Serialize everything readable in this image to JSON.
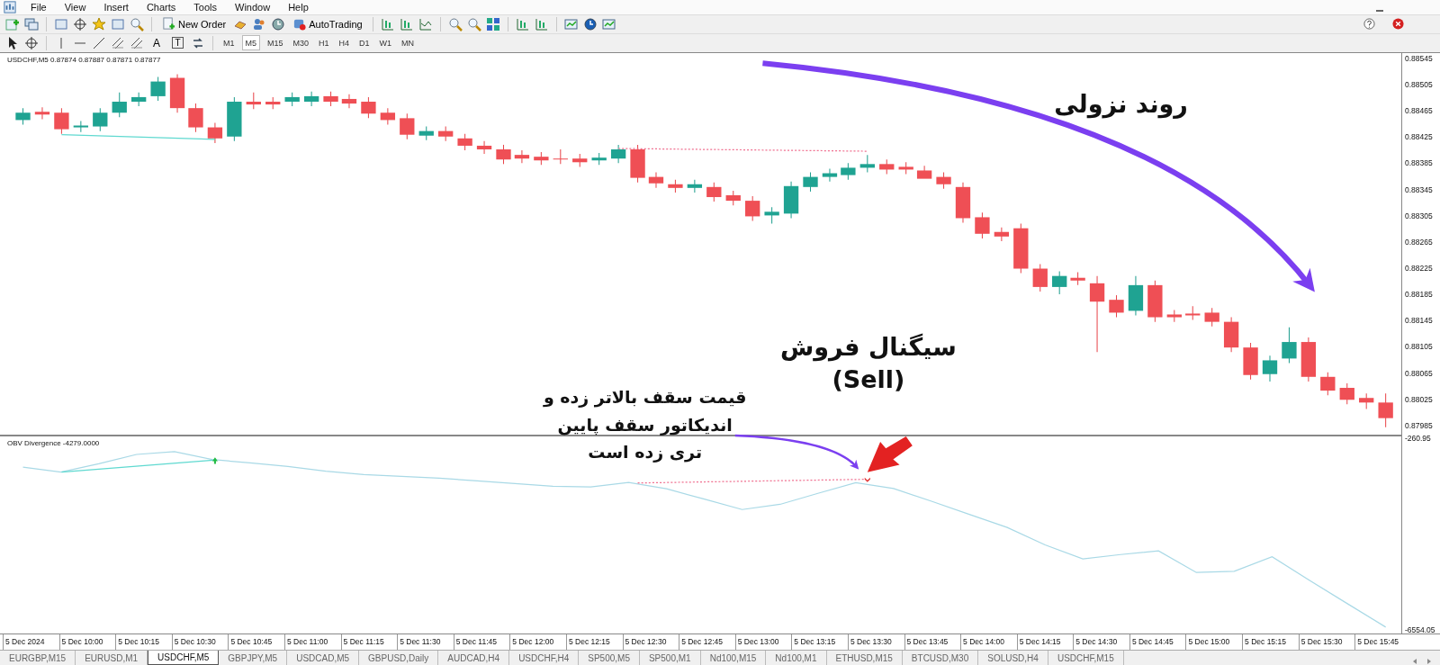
{
  "menu": [
    "File",
    "View",
    "Insert",
    "Charts",
    "Tools",
    "Window",
    "Help"
  ],
  "toolbar": {
    "new_order": "New Order",
    "auto_trading": "AutoTrading"
  },
  "drawing_tools": {
    "text_tool": "A",
    "label_tool": "T"
  },
  "timeframes": [
    {
      "label": "M1",
      "selected": false
    },
    {
      "label": "M5",
      "selected": true
    },
    {
      "label": "M15",
      "selected": false
    },
    {
      "label": "M30",
      "selected": false
    },
    {
      "label": "H1",
      "selected": false
    },
    {
      "label": "H4",
      "selected": false
    },
    {
      "label": "D1",
      "selected": false
    },
    {
      "label": "W1",
      "selected": false
    },
    {
      "label": "MN",
      "selected": false
    }
  ],
  "chart": {
    "header": "USDCHF,M5  0.87874 0.87887 0.87871 0.87877",
    "price_axis": [
      "0.88545",
      "0.88505",
      "0.88465",
      "0.88425",
      "0.88385",
      "0.88345",
      "0.88305",
      "0.88265",
      "0.88225",
      "0.88185",
      "0.88145",
      "0.88105",
      "0.88065",
      "0.88025",
      "0.87985"
    ],
    "trend_label": "روند نزولی",
    "signal_label": "سیگنال فروش",
    "signal_sub": "(Sell)",
    "note_lines": [
      "قیمت سقف بالاتر زده و",
      "اندیکاتور سقف پایین",
      "تری زده است"
    ]
  },
  "indicator": {
    "header": "OBV Divergence -4279.0000",
    "chart_data": {
      "type": "line",
      "ylim": [
        -6674,
        -201
      ],
      "yticks": [
        {
          "value": -260.95,
          "label": "-260.95"
        },
        {
          "value": -6554.05,
          "label": "-6554.05"
        }
      ],
      "series": [
        {
          "color": "#a9d9e6",
          "values": [
            -1210,
            -1370,
            -1100,
            -790,
            -700,
            -960,
            -1070,
            -1190,
            -1340,
            -1450,
            -1510,
            -1570,
            -1660,
            -1750,
            -1840,
            -1860,
            -1710,
            -1920,
            -2260,
            -2600,
            -2430,
            -2070,
            -1720,
            -1910,
            -2330,
            -2760,
            -3190,
            -3760,
            -4220,
            -4080,
            -3960,
            -4670,
            -4630,
            -4150,
            -4940,
            -5700,
            -6460
          ]
        }
      ]
    }
  },
  "time_axis": [
    "5 Dec 2024",
    "5 Dec 10:00",
    "5 Dec 10:15",
    "5 Dec 10:30",
    "5 Dec 10:45",
    "5 Dec 11:00",
    "5 Dec 11:15",
    "5 Dec 11:30",
    "5 Dec 11:45",
    "5 Dec 12:00",
    "5 Dec 12:15",
    "5 Dec 12:30",
    "5 Dec 12:45",
    "5 Dec 13:00",
    "5 Dec 13:15",
    "5 Dec 13:30",
    "5 Dec 13:45",
    "5 Dec 14:00",
    "5 Dec 14:15",
    "5 Dec 14:30",
    "5 Dec 14:45",
    "5 Dec 15:00",
    "5 Dec 15:15",
    "5 Dec 15:30",
    "5 Dec 15:45"
  ],
  "tabs": [
    {
      "label": "EURGBP,M15",
      "selected": false
    },
    {
      "label": "EURUSD,M1",
      "selected": false
    },
    {
      "label": "USDCHF,M5",
      "selected": true
    },
    {
      "label": "GBPJPY,M5",
      "selected": false
    },
    {
      "label": "USDCAD,M5",
      "selected": false
    },
    {
      "label": "GBPUSD,Daily",
      "selected": false
    },
    {
      "label": "AUDCAD,H4",
      "selected": false
    },
    {
      "label": "USDCHF,H4",
      "selected": false
    },
    {
      "label": "SP500,M5",
      "selected": false
    },
    {
      "label": "SP500,M1",
      "selected": false
    },
    {
      "label": "Nd100,M15",
      "selected": false
    },
    {
      "label": "Nd100,M1",
      "selected": false
    },
    {
      "label": "ETHUSD,M15",
      "selected": false
    },
    {
      "label": "BTCUSD,M30",
      "selected": false
    },
    {
      "label": "SOLUSD,H4",
      "selected": false
    },
    {
      "label": "USDCHF,M15",
      "selected": false
    }
  ]
}
